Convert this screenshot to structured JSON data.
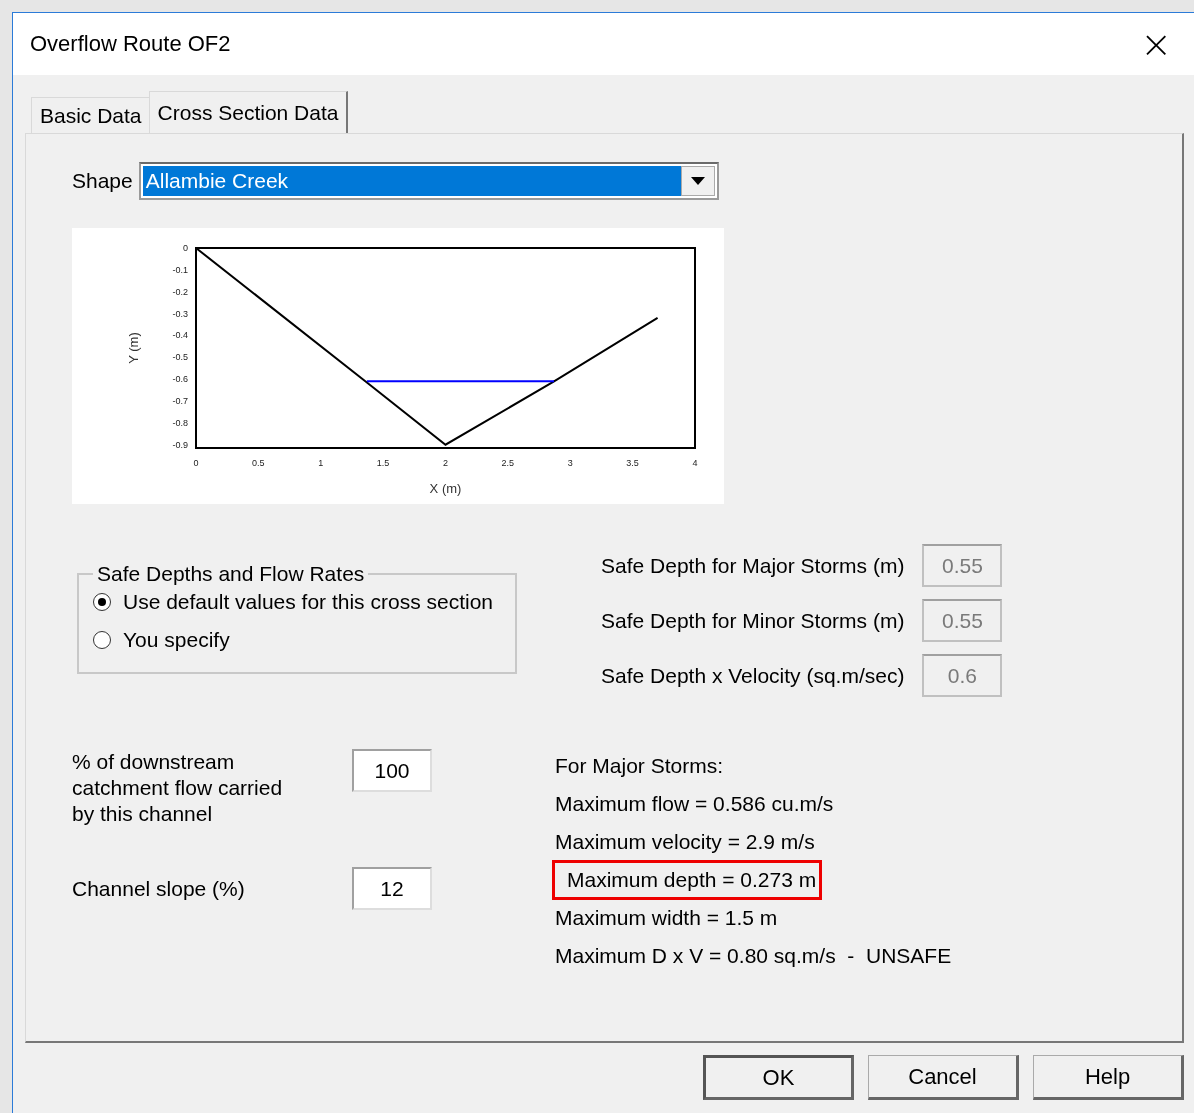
{
  "window": {
    "title": "Overflow Route OF2",
    "close": "×"
  },
  "tabs": [
    {
      "label": "Basic Data",
      "selected": false
    },
    {
      "label": "Cross Section Data",
      "selected": true
    }
  ],
  "shape": {
    "label": "Shape",
    "value": "Allambie Creek"
  },
  "chart_data": {
    "type": "line",
    "xlabel": "X (m)",
    "ylabel": "Y (m)",
    "x": [
      0,
      1.37,
      2,
      2.87,
      3.7
    ],
    "xlim": [
      0,
      4
    ],
    "ylim": [
      -0.915,
      0
    ],
    "xticks": [
      0,
      0.5,
      1,
      1.5,
      2,
      2.5,
      3,
      3.5,
      4
    ],
    "yticks": [
      0,
      -0.1,
      -0.2,
      -0.3,
      -0.4,
      -0.5,
      -0.6,
      -0.7,
      -0.8,
      -0.9
    ],
    "series": [
      {
        "color": "#000000",
        "values": [
          0,
          -0.615,
          -0.9,
          -0.61,
          -0.32
        ]
      },
      {
        "color": "#0000ff",
        "values": [
          null,
          -0.61,
          -0.61,
          -0.61,
          null
        ]
      }
    ]
  },
  "safe_depths": {
    "title": "Safe Depths and Flow Rates",
    "options": [
      {
        "label": "Use default values for this cross section",
        "selected": true
      },
      {
        "label": "You specify",
        "selected": false
      }
    ]
  },
  "safe_fields": [
    {
      "label": "Safe Depth for Major Storms (m)",
      "value": "0.55",
      "disabled": true
    },
    {
      "label": "Safe Depth for Minor Storms (m)",
      "value": "0.55",
      "disabled": true
    },
    {
      "label": "Safe Depth x Velocity (sq.m/sec)",
      "value": "0.6",
      "disabled": true
    }
  ],
  "inputs": [
    {
      "label": "% of downstream catchment flow carried by this channel",
      "value": "100"
    },
    {
      "label": "Channel slope (%)",
      "value": "12"
    }
  ],
  "results": [
    {
      "text": "For Major Storms:",
      "highlighted": false
    },
    {
      "text": "Maximum flow = 0.586 cu.m/s",
      "highlighted": false
    },
    {
      "text": "Maximum velocity = 2.9 m/s",
      "highlighted": false
    },
    {
      "text": "Maximum depth = 0.273 m",
      "highlighted": true
    },
    {
      "text": "Maximum width = 1.5 m",
      "highlighted": false
    },
    {
      "text": "Maximum D x V = 0.80 sq.m/s  -  UNSAFE",
      "highlighted": false
    }
  ],
  "buttons": [
    {
      "label": "OK",
      "default": true
    },
    {
      "label": "Cancel",
      "default": false
    },
    {
      "label": "Help",
      "default": false
    }
  ]
}
